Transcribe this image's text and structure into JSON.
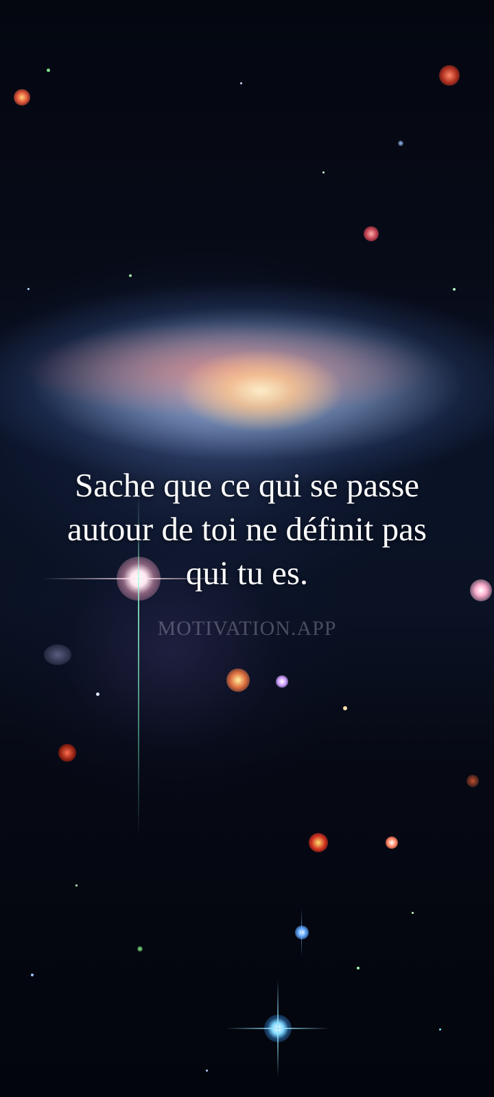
{
  "quote": {
    "line1": "Sache que ce qui se passe",
    "line2": "autour de toi ne définit pas",
    "line3": "qui tu es."
  },
  "watermark": "MOTIVATION.APP",
  "colors": {
    "text": "#ffffff",
    "background": "#03060f",
    "galaxy_core": "#ffe8c8",
    "galaxy_dust": "#ff7a64",
    "galaxy_halo": "#c8dcff"
  }
}
